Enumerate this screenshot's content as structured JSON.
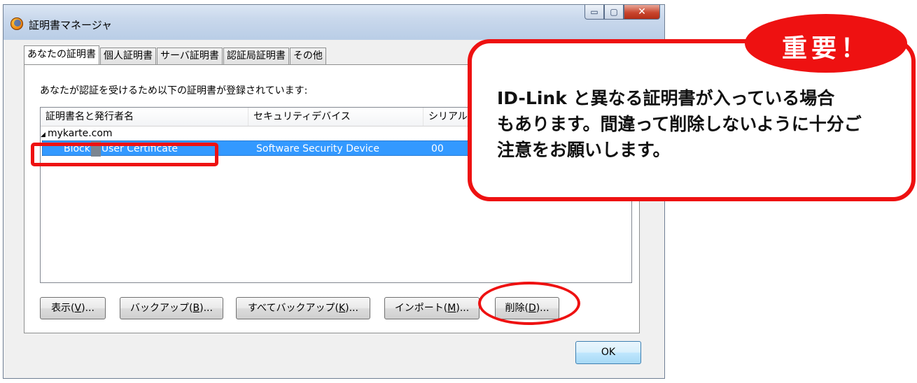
{
  "window": {
    "title": "証明書マネージャ",
    "controls": {
      "minimize": "▭",
      "maximize": "▢",
      "close": "✕"
    }
  },
  "tabs": [
    {
      "label": "あなたの証明書",
      "active": true
    },
    {
      "label": "個人証明書",
      "active": false
    },
    {
      "label": "サーバ証明書",
      "active": false
    },
    {
      "label": "認証局証明書",
      "active": false
    },
    {
      "label": "その他",
      "active": false
    }
  ],
  "panel": {
    "description": "あなたが認証を受けるため以下の証明書が登録されています:",
    "columns": [
      "証明書名と発行者名",
      "セキュリティデバイス",
      "シリアル"
    ],
    "group": {
      "expander": "◢",
      "label": "mykarte.com"
    },
    "rows": [
      {
        "name_pre": "Block",
        "name_post": "User Certificate",
        "device": "Software Security Device",
        "serial": "00",
        "selected": true
      }
    ],
    "buttons": [
      {
        "text": "表示(",
        "key": "V",
        "tail": ")..."
      },
      {
        "text": "バックアップ(",
        "key": "B",
        "tail": ")..."
      },
      {
        "text": "すべてバックアップ(",
        "key": "K",
        "tail": ")..."
      },
      {
        "text": "インポート(",
        "key": "M",
        "tail": ")..."
      },
      {
        "text": "削除(",
        "key": "D",
        "tail": ")..."
      }
    ]
  },
  "ok_label": "OK",
  "annotation": {
    "badge": "重要！",
    "lines": [
      "ID-Link と異なる証明書が入っている場合",
      "もあります。間違って削除しないように十分ご",
      "注意をお願いします。"
    ],
    "color": "#ee1111"
  },
  "colors": {
    "selection": "#3399ff",
    "window_bg": "#f0f0f0"
  }
}
